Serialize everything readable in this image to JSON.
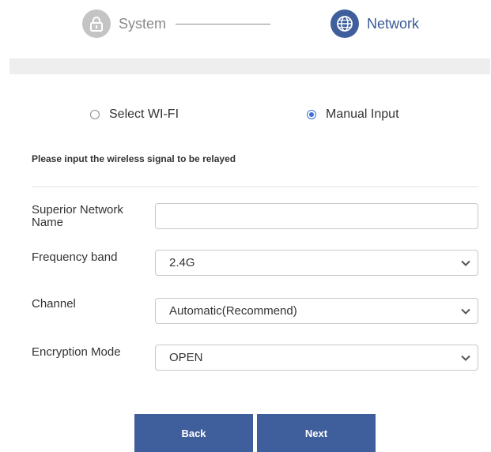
{
  "stepper": {
    "steps": [
      {
        "label": "System",
        "icon": "lock-icon",
        "state": "completed"
      },
      {
        "label": "Network",
        "icon": "globe-icon",
        "state": "active"
      }
    ]
  },
  "mode": {
    "options": [
      {
        "label": "Select WI-FI",
        "checked": false
      },
      {
        "label": "Manual Input",
        "checked": true
      }
    ]
  },
  "instruction": "Please input the wireless signal to be relayed",
  "form": {
    "network_name": {
      "label": "Superior Network Name",
      "value": "",
      "placeholder": ""
    },
    "frequency_band": {
      "label": "Frequency band",
      "value": "2.4G"
    },
    "channel": {
      "label": "Channel",
      "value": "Automatic(Recommend)"
    },
    "encryption": {
      "label": "Encryption Mode",
      "value": "OPEN"
    }
  },
  "buttons": {
    "back": "Back",
    "next": "Next"
  },
  "colors": {
    "primary": "#3f5e9c",
    "radio_accent": "#3a6fd8",
    "inactive_step": "#c4c4c4"
  }
}
